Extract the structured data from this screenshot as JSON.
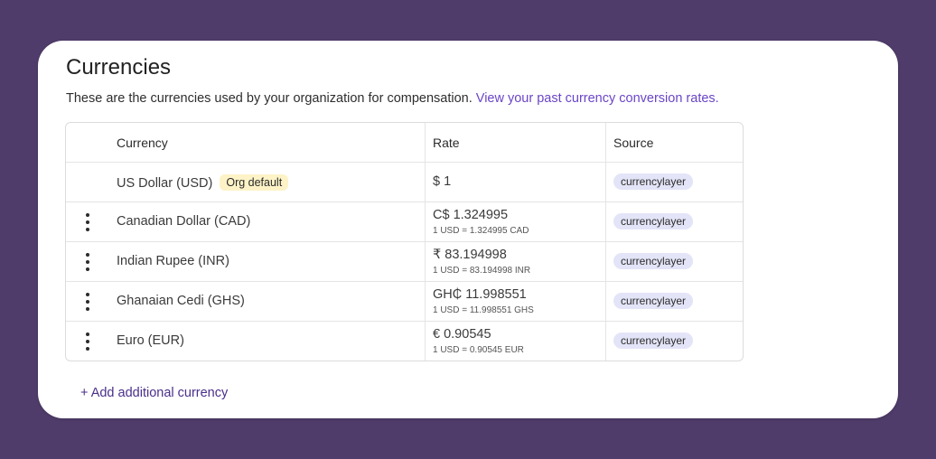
{
  "page": {
    "title": "Currencies",
    "description": "These are the currencies used by your organization for compensation.",
    "link_text": "View your past currency conversion rates.",
    "add_label": "+ Add additional currency"
  },
  "table": {
    "headers": {
      "currency": "Currency",
      "rate": "Rate",
      "source": "Source"
    },
    "rows": [
      {
        "currency": "US Dollar (USD)",
        "badge": "Org default",
        "rate": "$ 1",
        "rate_detail": "",
        "source": "currencylayer"
      },
      {
        "currency": "Canadian Dollar (CAD)",
        "badge": "",
        "rate": "C$ 1.324995",
        "rate_detail": "1 USD = 1.324995 CAD",
        "source": "currencylayer"
      },
      {
        "currency": "Indian Rupee (INR)",
        "badge": "",
        "rate": "₹ 83.194998",
        "rate_detail": "1 USD = 83.194998 INR",
        "source": "currencylayer"
      },
      {
        "currency": "Ghanaian Cedi (GHS)",
        "badge": "",
        "rate": "GH₵ 11.998551",
        "rate_detail": "1 USD = 11.998551 GHS",
        "source": "currencylayer"
      },
      {
        "currency": "Euro (EUR)",
        "badge": "",
        "rate": "€ 0.90545",
        "rate_detail": "1 USD = 0.90545 EUR",
        "source": "currencylayer"
      }
    ]
  },
  "colors": {
    "background": "#4f3c6a",
    "link": "#6a45c8",
    "org_default_badge": "#fdf3c7",
    "source_badge": "#e3e4f7"
  },
  "icons": {
    "row_menu": "more-vertical-icon"
  }
}
